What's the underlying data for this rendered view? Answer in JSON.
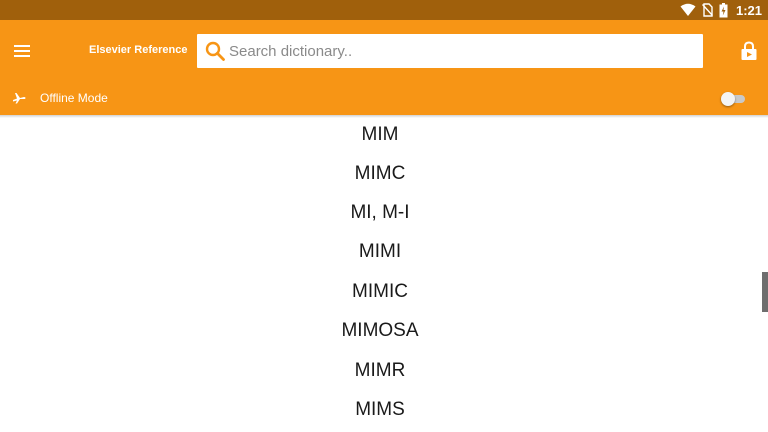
{
  "status_bar": {
    "time": "1:21",
    "icons": [
      "wifi-icon",
      "no-sim-icon",
      "battery-charging-icon"
    ]
  },
  "app_bar": {
    "menu_icon": "hamburger-menu-icon",
    "title": "Elsevier Reference",
    "search": {
      "placeholder": "Search dictionary..",
      "value": "",
      "icon": "search-icon"
    },
    "lock_icon": "lock-icon"
  },
  "offline": {
    "icon": "airplane-icon",
    "label": "Offline Mode",
    "enabled": false
  },
  "terms": [
    "MIM",
    "MIMC",
    "MI, M-I",
    "MIMI",
    "MIMIC",
    "MIMOSA",
    "MIMR",
    "MIMS"
  ],
  "colors": {
    "accent": "#f79515",
    "status_bar": "#a0600c",
    "text": "#1a1a1a"
  }
}
